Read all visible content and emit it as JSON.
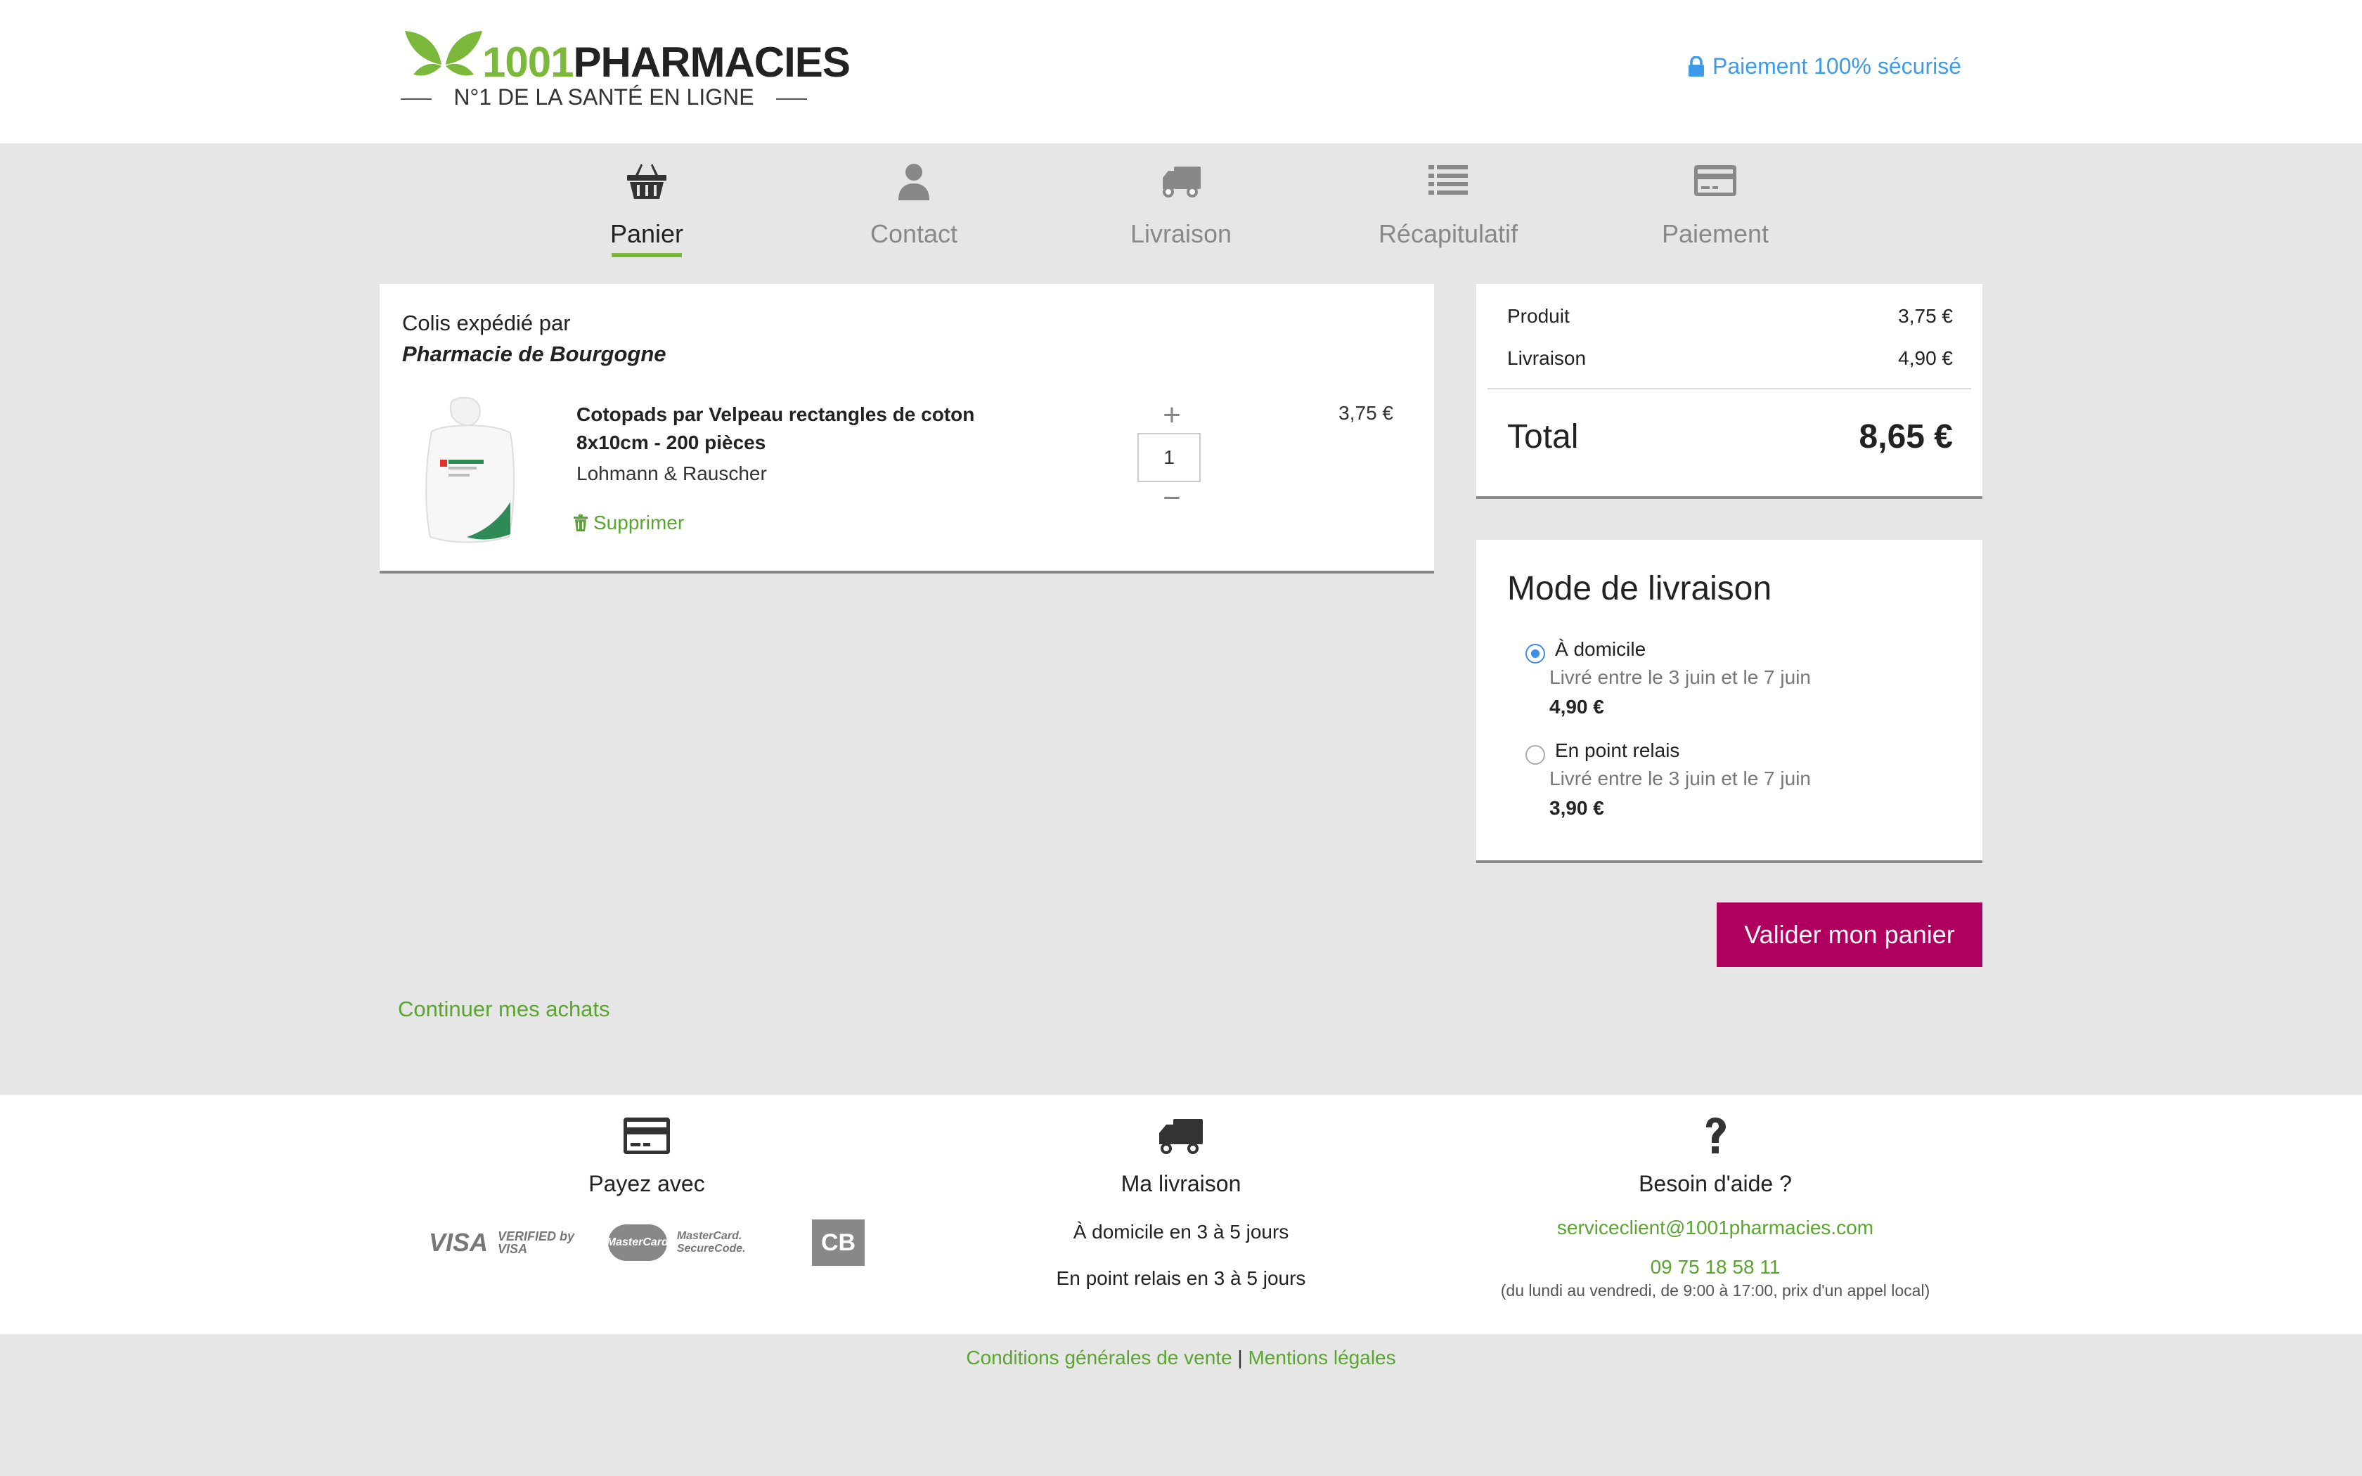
{
  "header": {
    "logo_number": "1001",
    "logo_name": "PHARMACIES",
    "logo_tagline": "N°1 DE LA SANTÉ EN LIGNE",
    "secure_text": "Paiement 100% sécurisé"
  },
  "steps": [
    {
      "label": "Panier",
      "icon": "basket-icon",
      "active": true
    },
    {
      "label": "Contact",
      "icon": "user-icon",
      "active": false
    },
    {
      "label": "Livraison",
      "icon": "truck-icon",
      "active": false
    },
    {
      "label": "Récapitulatif",
      "icon": "list-icon",
      "active": false
    },
    {
      "label": "Paiement",
      "icon": "credit-card-icon",
      "active": false
    }
  ],
  "cart": {
    "shipped_by_label": "Colis expédié par",
    "pharmacy": "Pharmacie de Bourgogne",
    "item": {
      "name": "Cotopads par Velpeau rectangles de coton 8x10cm - 200 pièces",
      "brand": "Lohmann & Rauscher",
      "remove_label": "Supprimer",
      "quantity": "1",
      "plus": "+",
      "minus": "−",
      "price": "3,75 €"
    }
  },
  "summary": {
    "product_label": "Produit",
    "product_value": "3,75 €",
    "delivery_label": "Livraison",
    "delivery_value": "4,90 €",
    "total_label": "Total",
    "total_value": "8,65 €"
  },
  "delivery_mode": {
    "title": "Mode de livraison",
    "options": [
      {
        "name": "À domicile",
        "desc": "Livré entre le 3 juin et le 7 juin",
        "price": "4,90 €",
        "selected": true
      },
      {
        "name": "En point relais",
        "desc": "Livré entre le 3 juin et le 7 juin",
        "price": "3,90 €",
        "selected": false
      }
    ]
  },
  "actions": {
    "validate_label": "Valider mon panier",
    "continue_label": "Continuer mes achats"
  },
  "footer": {
    "pay": {
      "title": "Payez avec",
      "cards": [
        "VISA",
        "VERIFIED by VISA",
        "MasterCard",
        "MasterCard. SecureCode.",
        "CB"
      ]
    },
    "shipping": {
      "title": "Ma livraison",
      "line1": "À domicile en 3 à 5 jours",
      "line2": "En point relais en 3 à 5 jours"
    },
    "help": {
      "title": "Besoin d'aide ?",
      "email": "serviceclient@1001pharmacies.com",
      "phone": "09 75 18 58 11",
      "hours": "(du lundi au vendredi, de 9:00 à 17:00, prix d'un appel local)"
    },
    "cgv": "Conditions générales de vente",
    "separator": "|",
    "legal": "Mentions légales"
  },
  "colors": {
    "brand_green": "#7cb83a",
    "link_green": "#5aa52f",
    "accent_magenta": "#b0005f",
    "secure_blue": "#3d9be9"
  }
}
